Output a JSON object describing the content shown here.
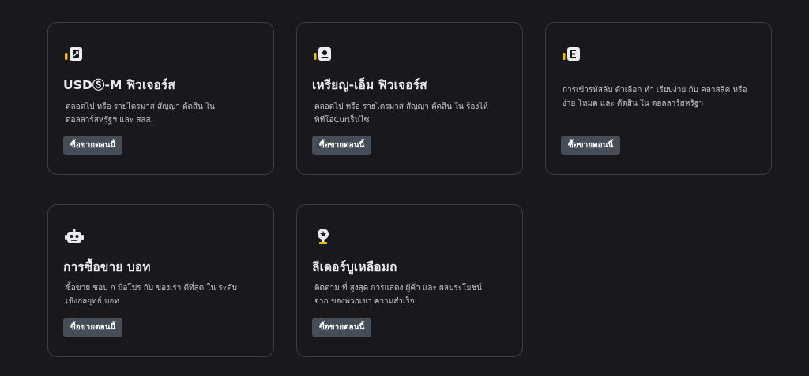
{
  "cards": [
    {
      "title": "USDⓈ-M ฟิวเจอร์ส",
      "description": "ตลอดไป หรือ รายไตรมาส สัญญา ตัดสิน ใน ดอลลาร์สหรัฐฯ และ สสส.",
      "button": "ซื้อขายตอนนี้",
      "icon": "usdm-futures-icon"
    },
    {
      "title": "เหรียญ-เอ็ม ฟิวเจอร์ส",
      "description": "ตลอดไป หรือ รายไตรมาส สัญญา ตัดสิน ใน ร้องไห้ พิทีโอCurเร็นไซ",
      "button": "ซื้อขายตอนนี้",
      "icon": "coinm-futures-icon"
    },
    {
      "title": "",
      "description": "การเข้ารหัสลับ ตัวเลือก ทำ เรียบง่าย กับ คลาสสิค หรือ ง่าย โหมด และ ตัดสิน ใน ดอลลาร์สหรัฐฯ",
      "button": "ซื้อขายตอนนี้",
      "icon": "options-icon"
    },
    {
      "title": "การซื้อขาย บอท",
      "description": "ซื้อขาย ชอบ ก มือโปร กับ ของเรา ดีที่สุด ใน ระดับ เชิงกลยุทธ์ บอท",
      "button": "ซื้อขายตอนนี้",
      "icon": "bot-icon"
    },
    {
      "title": "ลีเดอร์บูเหลือมถ",
      "description": "ติดตาม ที่ สูงสุด การแสดง ผู้ค้า และ ผลประโยชน์ จาก ของพวกเขา ความสำเร็จ.",
      "button": "ซื้อขายตอนนี้",
      "icon": "leaderboard-icon"
    }
  ],
  "colors": {
    "background": "#18181d",
    "card_border": "#3a3d44",
    "accent_yellow": "#f0b90b",
    "button_bg": "#474d57"
  }
}
